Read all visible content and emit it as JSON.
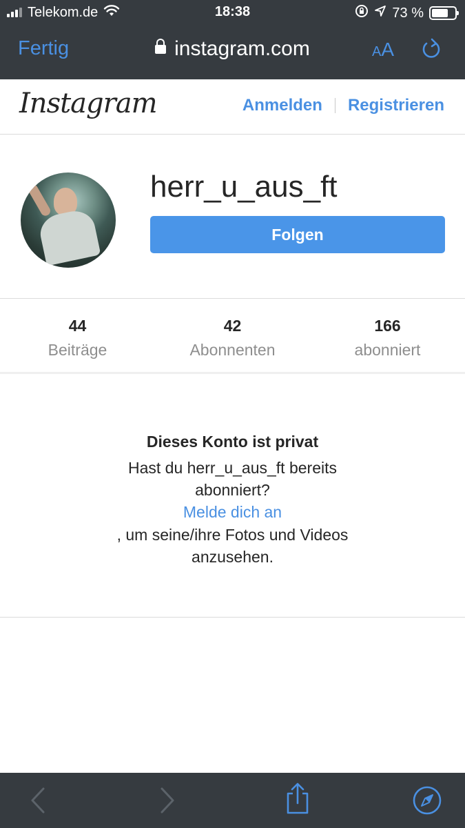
{
  "status_bar": {
    "carrier": "Telekom.de",
    "time": "18:38",
    "battery": "73 %",
    "battery_level": 0.73
  },
  "safari": {
    "done_label": "Fertig",
    "url": "instagram.com",
    "text_size_label_small": "A",
    "text_size_label_large": "A"
  },
  "instagram": {
    "logo": "Instagram",
    "login_label": "Anmelden",
    "register_label": "Registrieren"
  },
  "profile": {
    "username": "herr_u_aus_ft",
    "follow_label": "Folgen"
  },
  "stats": [
    {
      "value": "44",
      "label": "Beiträge"
    },
    {
      "value": "42",
      "label": "Abonnenten"
    },
    {
      "value": "166",
      "label": "abonniert"
    }
  ],
  "private_notice": {
    "title": "Dieses Konto ist privat",
    "line1": "Hast du herr_u_aus_ft bereits",
    "line2": "abonniert?",
    "link": "Melde dich an",
    "line3": ", um seine/ihre Fotos und Videos",
    "line4": "anzusehen."
  },
  "colors": {
    "accent": "#4a90e2",
    "follow_button": "#4a95e8",
    "browser_chrome": "#363b40"
  }
}
